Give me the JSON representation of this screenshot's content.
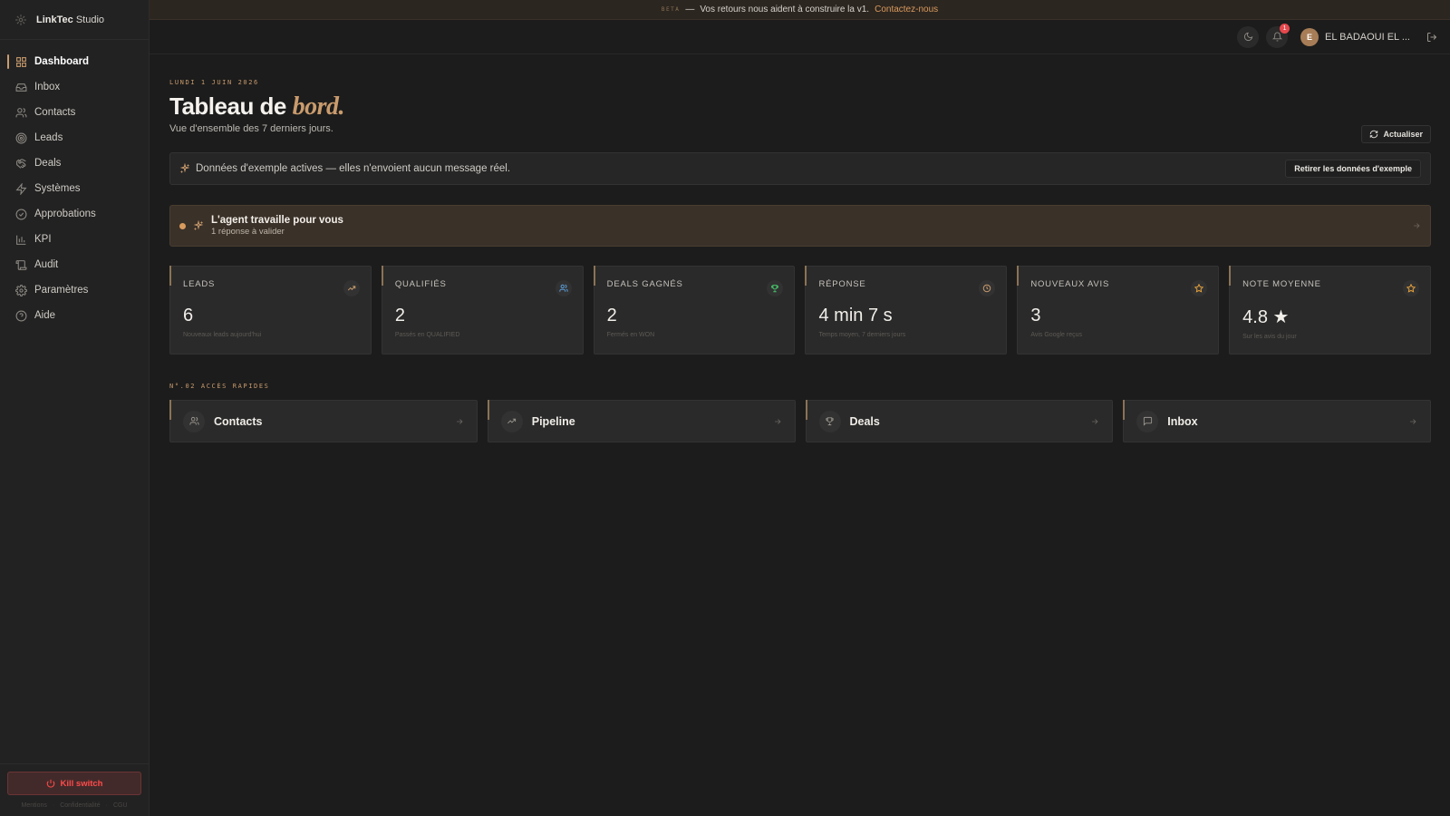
{
  "brand": {
    "name": "LinkTec",
    "suffix": "Studio"
  },
  "sidebar": {
    "items": [
      {
        "label": "Dashboard",
        "icon": "grid-icon",
        "active": true
      },
      {
        "label": "Inbox",
        "icon": "inbox-icon"
      },
      {
        "label": "Contacts",
        "icon": "users-icon"
      },
      {
        "label": "Leads",
        "icon": "target-icon"
      },
      {
        "label": "Deals",
        "icon": "handshake-icon"
      },
      {
        "label": "Systèmes",
        "icon": "zap-icon"
      },
      {
        "label": "Approbations",
        "icon": "check-circle-icon"
      },
      {
        "label": "KPI",
        "icon": "bar-chart-icon"
      },
      {
        "label": "Audit",
        "icon": "scroll-icon"
      },
      {
        "label": "Paramètres",
        "icon": "gear-icon"
      },
      {
        "label": "Aide",
        "icon": "help-circle-icon"
      }
    ],
    "kill_switch": "Kill switch",
    "legal": [
      "Mentions",
      "Confidentialité",
      "CGU"
    ]
  },
  "beta_banner": {
    "tag": "BETA",
    "dash": "—",
    "message": "Vos retours nous aident à construire la v1.",
    "link": "Contactez-nous"
  },
  "topbar": {
    "notification_count": "1",
    "avatar_initial": "E",
    "user_name": "EL BADAOUI EL ..."
  },
  "header": {
    "date": "LUNDI 1 JUIN 2026",
    "title_main": "Tableau de",
    "title_accent": "bord.",
    "subtitle": "Vue d'ensemble des 7 derniers jours.",
    "refresh": "Actualiser"
  },
  "demo_banner": {
    "message": "Données d'exemple actives — elles n'envoient aucun message réel.",
    "remove": "Retirer les données d'exemple"
  },
  "agent": {
    "title": "L'agent travaille pour vous",
    "subtitle": "1 réponse à valider"
  },
  "kpis": [
    {
      "label": "LEADS",
      "value": "6",
      "caption": "Nouveaux leads aujourd'hui",
      "icon": "trending-up-icon",
      "color": "#c99b6d"
    },
    {
      "label": "QUALIFIÉS",
      "value": "2",
      "caption": "Passés en QUALIFIED",
      "icon": "users-icon",
      "color": "#5b9bd5"
    },
    {
      "label": "DEALS GAGNÉS",
      "value": "2",
      "caption": "Fermés en WON",
      "icon": "trophy-icon",
      "color": "#46c46a"
    },
    {
      "label": "RÉPONSE",
      "value": "4 min 7 s",
      "caption": "Temps moyen, 7 derniers jours",
      "icon": "clock-icon",
      "color": "#c99b6d"
    },
    {
      "label": "NOUVEAUX AVIS",
      "value": "3",
      "caption": "Avis Google reçus",
      "icon": "star-icon",
      "color": "#e8a33c"
    },
    {
      "label": "NOTE MOYENNE",
      "value": "4.8 ★",
      "caption": "Sur les avis du jour",
      "icon": "star-icon",
      "color": "#e8a33c"
    }
  ],
  "quick_access": {
    "label": "N°.02 ACCÈS RAPIDES",
    "items": [
      {
        "label": "Contacts",
        "icon": "users-icon"
      },
      {
        "label": "Pipeline",
        "icon": "trending-up-icon"
      },
      {
        "label": "Deals",
        "icon": "trophy-icon"
      },
      {
        "label": "Inbox",
        "icon": "message-square-icon"
      }
    ]
  }
}
